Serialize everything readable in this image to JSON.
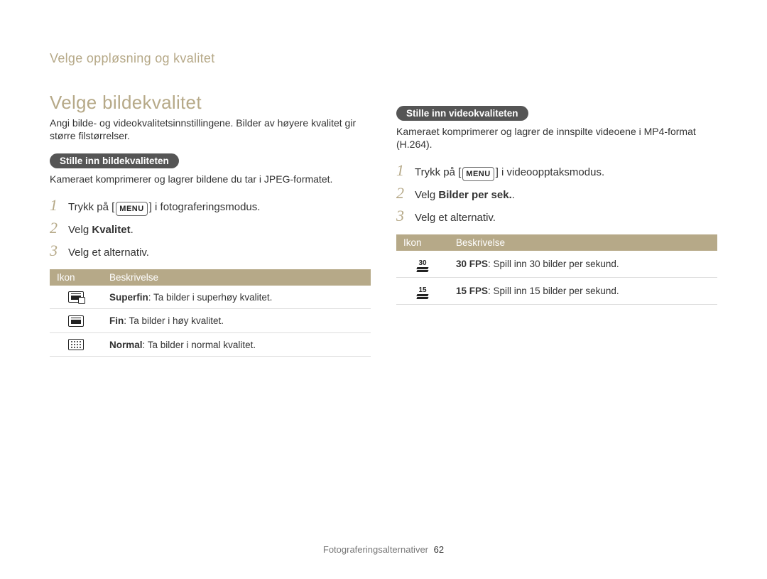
{
  "header": {
    "breadcrumb": "Velge oppløsning og kvalitet"
  },
  "sectionTitle": "Velge bildekvalitet",
  "left": {
    "intro": "Angi bilde- og videokvalitetsinnstillingene. Bilder av høyere kvalitet gir større filstørrelser.",
    "subheading": "Stille inn bildekvaliteten",
    "body": "Kameraet komprimerer og lagrer bildene du tar i JPEG-formatet.",
    "steps": {
      "s1_pre": "Trykk på [",
      "s1_menu": "MENU",
      "s1_post": "] i fotograferingsmodus.",
      "s2_pre": "Velg ",
      "s2_bold": "Kvalitet",
      "s2_post": ".",
      "s3": "Velg et alternativ."
    },
    "table": {
      "head_icon": "Ikon",
      "head_desc": "Beskrivelse",
      "rows": [
        {
          "iconName": "quality-superfine-icon",
          "bold": "Superfin",
          "rest": ": Ta bilder i superhøy kvalitet."
        },
        {
          "iconName": "quality-fine-icon",
          "bold": "Fin",
          "rest": ": Ta bilder i høy kvalitet."
        },
        {
          "iconName": "quality-normal-icon",
          "bold": "Normal",
          "rest": ": Ta bilder i normal kvalitet."
        }
      ]
    }
  },
  "right": {
    "subheading": "Stille inn videokvaliteten",
    "body": "Kameraet komprimerer og lagrer de innspilte videoene i MP4-format (H.264).",
    "steps": {
      "s1_pre": "Trykk på [",
      "s1_menu": "MENU",
      "s1_post": "] i videoopptaksmodus.",
      "s2_pre": "Velg ",
      "s2_bold": "Bilder per sek.",
      "s2_post": ".",
      "s3": "Velg et alternativ."
    },
    "table": {
      "head_icon": "Ikon",
      "head_desc": "Beskrivelse",
      "rows": [
        {
          "iconName": "fps-30-icon",
          "fps": "30",
          "bold": "30 FPS",
          "rest": ": Spill inn 30 bilder per sekund."
        },
        {
          "iconName": "fps-15-icon",
          "fps": "15",
          "bold": "15 FPS",
          "rest": ": Spill inn 15 bilder per sekund."
        }
      ]
    }
  },
  "footer": {
    "section": "Fotograferingsalternativer",
    "page": "62"
  }
}
